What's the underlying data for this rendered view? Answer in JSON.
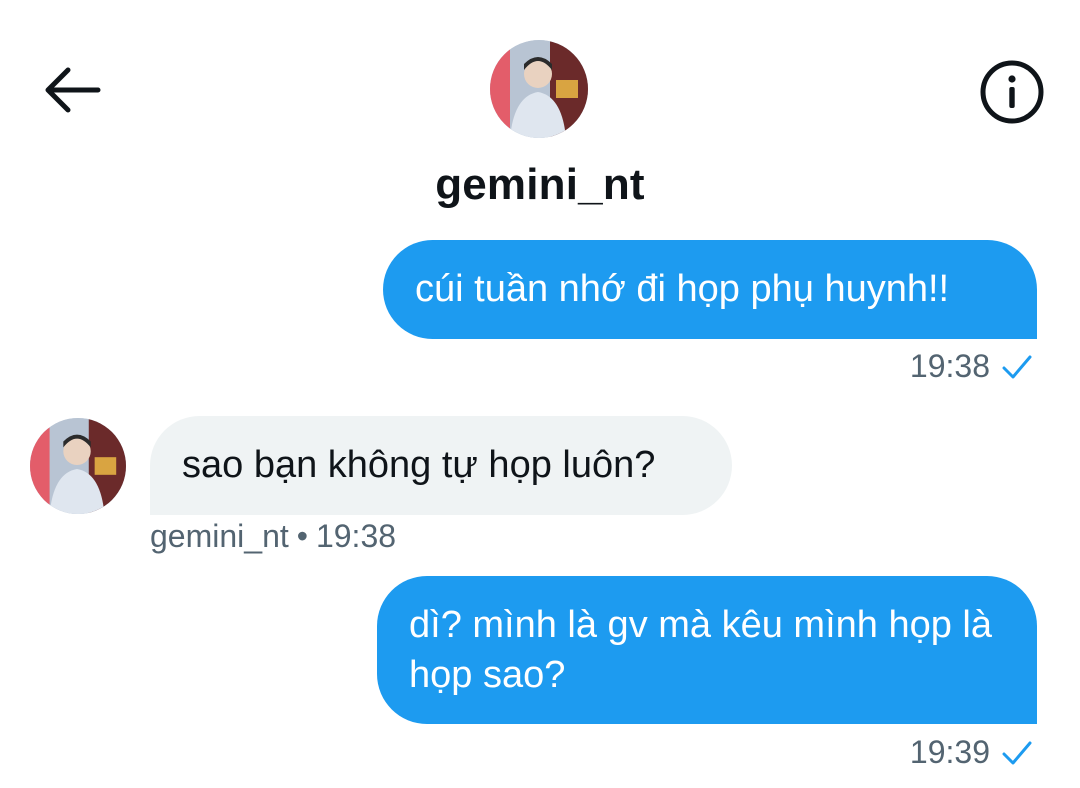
{
  "header": {
    "username": "gemini_nt",
    "back_icon": "arrow-left-icon",
    "info_icon": "info-circle-icon"
  },
  "messages": [
    {
      "direction": "outgoing",
      "text": "cúi tuần nhớ đi họp phụ huynh!!",
      "time": "19:38",
      "status_icon": "check-icon"
    },
    {
      "direction": "incoming",
      "sender": "gemini_nt",
      "separator": "•",
      "text": "sao bạn không tự họp luôn?",
      "time": "19:38"
    },
    {
      "direction": "outgoing",
      "text": "dì? mình là gv mà kêu mình họp là họp sao?",
      "time": "19:39",
      "status_icon": "check-icon"
    }
  ],
  "colors": {
    "outgoing_bubble": "#1d9bf0",
    "incoming_bubble": "#eff3f4",
    "meta_text": "#536471",
    "check": "#1d9bf0"
  }
}
